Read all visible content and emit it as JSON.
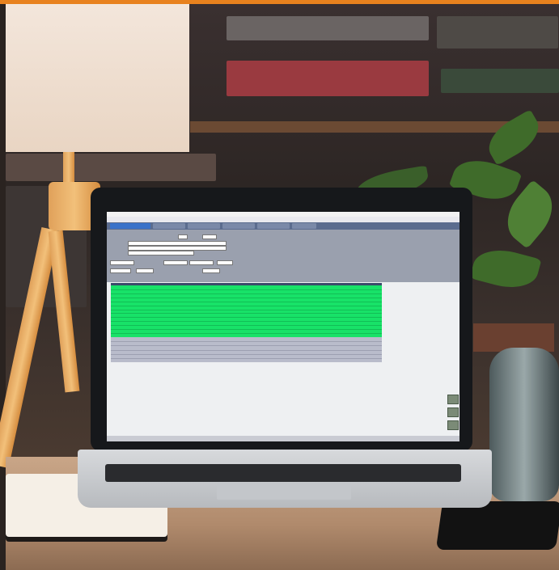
{
  "scene": {
    "description_objects": [
      "desk-lamp",
      "bookshelf",
      "plant",
      "glass-jar",
      "laptop",
      "notebook",
      "smartphone"
    ]
  },
  "app": {
    "menu_items": [
      "",
      "",
      "",
      "",
      "",
      "",
      "",
      ""
    ],
    "grid": {
      "highlighted_rows": 13,
      "normal_rows": 6
    }
  },
  "colors": {
    "accent_top": "#e8821e",
    "grid_highlight": "#18e268",
    "tab_bar": "#5b6c8e"
  }
}
